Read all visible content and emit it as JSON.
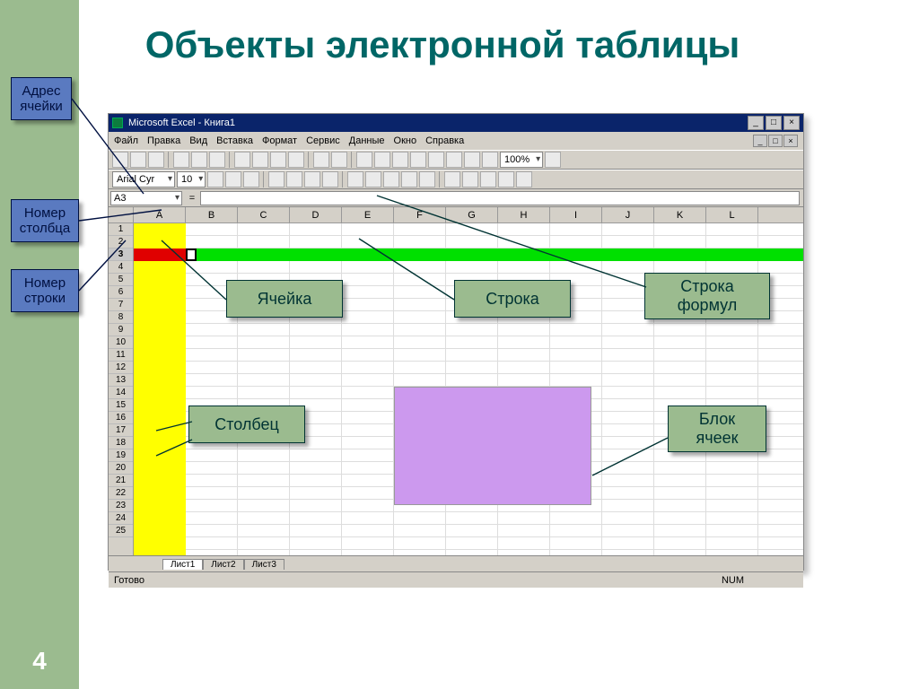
{
  "slide": {
    "title": "Объекты электронной таблицы",
    "number": "4"
  },
  "excel": {
    "title": "Microsoft Excel - Книга1",
    "menu": [
      "Файл",
      "Правка",
      "Вид",
      "Вставка",
      "Формат",
      "Сервис",
      "Данные",
      "Окно",
      "Справка"
    ],
    "font_name": "Arial Cyr",
    "font_size": "10",
    "zoom": "100%",
    "namebox": "A3",
    "columns": [
      "A",
      "B",
      "C",
      "D",
      "E",
      "F",
      "G",
      "H",
      "I",
      "J",
      "K",
      "L"
    ],
    "rows": [
      "1",
      "2",
      "3",
      "4",
      "5",
      "6",
      "7",
      "8",
      "9",
      "10",
      "11",
      "12",
      "13",
      "14",
      "15",
      "16",
      "17",
      "18",
      "19",
      "20",
      "21",
      "22",
      "23",
      "24",
      "25"
    ],
    "selected_row": "3",
    "sheets": {
      "active": "Лист1",
      "others": [
        "Лист2",
        "Лист3"
      ]
    },
    "status": "Готово",
    "status_flag": "NUM"
  },
  "callouts": {
    "cell_address": "Адрес ячейки",
    "col_number": "Номер столбца",
    "row_number": "Номер строки",
    "cell": "Ячейка",
    "row": "Строка",
    "formula_bar": "Строка формул",
    "column": "Столбец",
    "block": "Блок ячеек"
  }
}
